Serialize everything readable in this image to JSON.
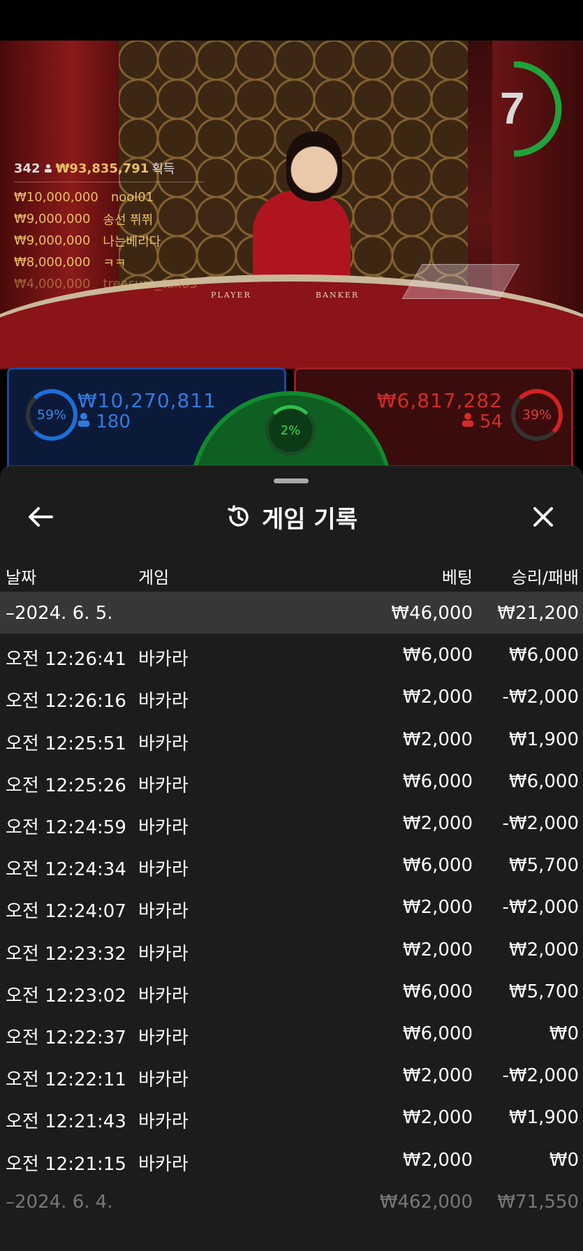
{
  "timer": {
    "value": "7"
  },
  "winners": {
    "count": "342",
    "total": "₩93,835,791",
    "label": "획득",
    "rows": [
      {
        "amount": "₩10,000,000",
        "name": "nool01"
      },
      {
        "amount": "₩9,000,000",
        "name": "송선 쮜쮜"
      },
      {
        "amount": "₩9,000,000",
        "name": "나는베리다"
      },
      {
        "amount": "₩8,000,000",
        "name": "ㅋㅋ"
      },
      {
        "amount": "₩4,000,000",
        "name": "treasure_tak05"
      }
    ]
  },
  "table_labels": {
    "player": "PLAYER",
    "banker": "BANKER"
  },
  "betting": {
    "player": {
      "percent": "59%",
      "amount": "₩10,270,811",
      "players": "180"
    },
    "banker": {
      "percent": "39%",
      "amount": "₩6,817,282",
      "players": "54"
    },
    "tie": {
      "percent": "2%"
    }
  },
  "colors": {
    "player": "#1d6fd6",
    "banker": "#d42121",
    "tie": "#2fc04a",
    "sheet": "#1c1c1c",
    "group_row": "#373737"
  },
  "history": {
    "title": "게임 기록",
    "columns": {
      "date": "날짜",
      "game": "게임",
      "bet": "베팅",
      "result": "승리/패배"
    },
    "groups": [
      {
        "date": "–2024. 6. 5.",
        "bet": "₩46,000",
        "result": "₩21,200",
        "records": [
          {
            "time": "오전 12:26:41",
            "game": "바카라",
            "bet": "₩6,000",
            "result": "₩6,000"
          },
          {
            "time": "오전 12:26:16",
            "game": "바카라",
            "bet": "₩2,000",
            "result": "-₩2,000"
          },
          {
            "time": "오전 12:25:51",
            "game": "바카라",
            "bet": "₩2,000",
            "result": "₩1,900"
          },
          {
            "time": "오전 12:25:26",
            "game": "바카라",
            "bet": "₩6,000",
            "result": "₩6,000"
          },
          {
            "time": "오전 12:24:59",
            "game": "바카라",
            "bet": "₩2,000",
            "result": "-₩2,000"
          },
          {
            "time": "오전 12:24:34",
            "game": "바카라",
            "bet": "₩6,000",
            "result": "₩5,700"
          },
          {
            "time": "오전 12:24:07",
            "game": "바카라",
            "bet": "₩2,000",
            "result": "-₩2,000"
          },
          {
            "time": "오전 12:23:32",
            "game": "바카라",
            "bet": "₩2,000",
            "result": "₩2,000"
          },
          {
            "time": "오전 12:23:02",
            "game": "바카라",
            "bet": "₩6,000",
            "result": "₩5,700"
          },
          {
            "time": "오전 12:22:37",
            "game": "바카라",
            "bet": "₩6,000",
            "result": "₩0"
          },
          {
            "time": "오전 12:22:11",
            "game": "바카라",
            "bet": "₩2,000",
            "result": "-₩2,000"
          },
          {
            "time": "오전 12:21:43",
            "game": "바카라",
            "bet": "₩2,000",
            "result": "₩1,900"
          },
          {
            "time": "오전 12:21:15",
            "game": "바카라",
            "bet": "₩2,000",
            "result": "₩0"
          }
        ]
      },
      {
        "date": "–2024. 6. 4.",
        "bet": "₩462,000",
        "result": "₩71,550",
        "records": []
      }
    ]
  },
  "icons": {
    "back": "arrow-left-icon",
    "history": "history-icon",
    "close": "close-icon",
    "person": "person-icon"
  }
}
